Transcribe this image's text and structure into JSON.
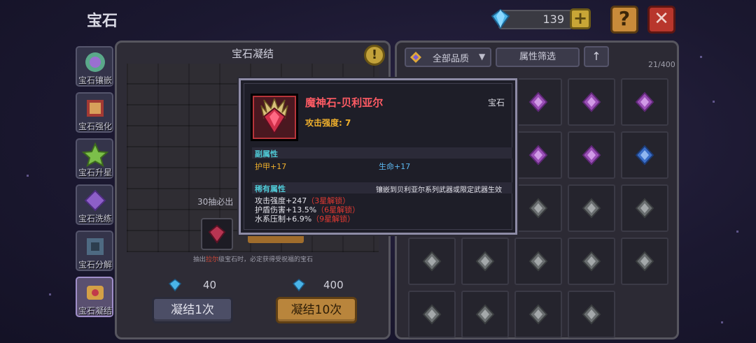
{
  "header": {
    "title": "宝石",
    "currency_value": "139",
    "plus_symbol": "+",
    "help_symbol": "?",
    "close_symbol": "✕"
  },
  "sidebar": {
    "items": [
      {
        "label": "宝石镶嵌",
        "icon": "inlay-gem-icon"
      },
      {
        "label": "宝石强化",
        "icon": "enhance-book-icon"
      },
      {
        "label": "宝石升星",
        "icon": "star-upgrade-icon"
      },
      {
        "label": "宝石洗练",
        "icon": "reforge-gem-icon"
      },
      {
        "label": "宝石分解",
        "icon": "decompose-icon"
      },
      {
        "label": "宝石凝结",
        "icon": "condense-scroll-icon"
      }
    ],
    "active_index": 5
  },
  "left_panel": {
    "title": "宝石凝结",
    "warning_symbol": "!",
    "pity_text": "30抽必出",
    "note_prefix": "抽出",
    "note_highlight": "拉尔",
    "note_suffix": "级宝石时，必定获得受祝福的宝石",
    "single": {
      "cost": "40",
      "label": "凝结1次"
    },
    "ten": {
      "cost": "400",
      "label": "凝结10次"
    }
  },
  "right_panel": {
    "quality_filter": "全部品质",
    "attribute_filter": "属性筛选",
    "sort_symbol": "↑",
    "count": "21/400",
    "slot_gems": [
      "purple",
      "purple",
      "purple",
      "purple",
      "purple",
      "purple",
      "purple",
      "purple",
      "purple",
      "blue",
      "blue",
      "blue",
      "grey",
      "grey",
      "grey",
      "grey",
      "grey",
      "grey",
      "grey",
      "grey",
      "grey",
      "grey",
      "grey",
      "grey"
    ]
  },
  "tooltip": {
    "name": "魔神石-贝利亚尔",
    "type": "宝石",
    "main_stat": "攻击强度: 7",
    "sub_attr_title": "副属性",
    "sub_attr_1": "护甲+17",
    "sub_attr_2": "生命+17",
    "rare_attr_title": "稀有属性",
    "rare_attr_desc": "镶嵌到贝利亚尔系列武器或限定武器生效",
    "rare_lines": [
      {
        "text": "攻击强度+247",
        "lock": "（3星解锁）"
      },
      {
        "text": "护盾伤害+13.5%",
        "lock": "（6星解锁）"
      },
      {
        "text": "水系压制+6.9%",
        "lock": "（9星解锁）"
      }
    ]
  },
  "colors": {
    "tooltip_name": "#ff5b64",
    "main_stat": "#f0b02c",
    "section_title": "#4fc9d6",
    "hp_stat": "#5cb8f0",
    "lock_red": "#e53a32",
    "gem_purple": "#9a4fb6",
    "gem_blue": "#3a6ec8"
  }
}
